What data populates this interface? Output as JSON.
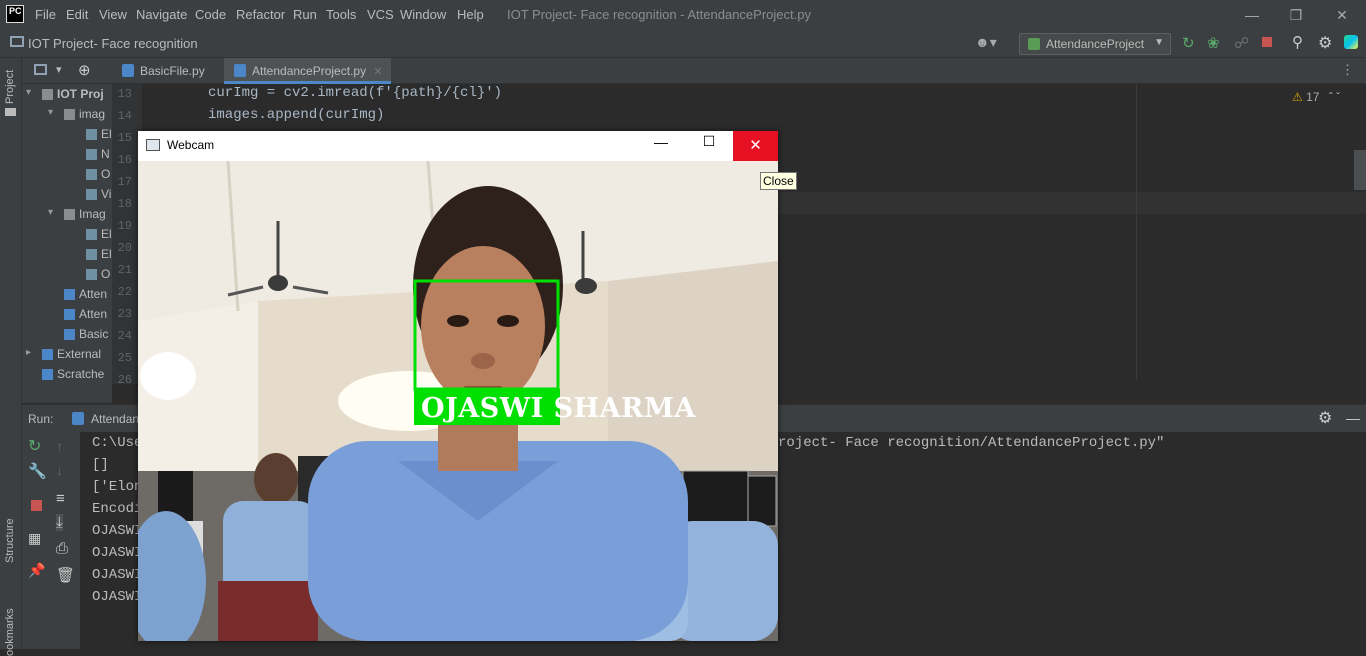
{
  "app": {
    "logo": "PC",
    "window_title": "IOT Project- Face recognition - AttendanceProject.py",
    "menu": [
      "File",
      "Edit",
      "View",
      "Navigate",
      "Code",
      "Refactor",
      "Run",
      "Tools",
      "VCS",
      "Window",
      "Help"
    ]
  },
  "navbar": {
    "project": "IOT Project- Face recognition",
    "run_config": "AttendanceProject"
  },
  "sidebar": {
    "project_label": "Project",
    "structure_label": "Structure",
    "bookmarks_label": "ookmarks"
  },
  "project_tree": [
    {
      "label": "IOT Proj",
      "indent": 0
    },
    {
      "label": "imag",
      "indent": 1
    },
    {
      "label": "El",
      "indent": 2
    },
    {
      "label": "N",
      "indent": 2
    },
    {
      "label": "O",
      "indent": 2
    },
    {
      "label": "Vi",
      "indent": 2
    },
    {
      "label": "Imag",
      "indent": 1
    },
    {
      "label": "El",
      "indent": 2
    },
    {
      "label": "El",
      "indent": 2
    },
    {
      "label": "O",
      "indent": 2
    },
    {
      "label": "Atten",
      "indent": 1
    },
    {
      "label": "Atten",
      "indent": 1
    },
    {
      "label": "Basic",
      "indent": 1
    },
    {
      "label": "External",
      "indent": 0
    },
    {
      "label": "Scratche",
      "indent": 0
    }
  ],
  "tabs": [
    {
      "label": "BasicFile.py",
      "active": false
    },
    {
      "label": "AttendanceProject.py",
      "active": true
    }
  ],
  "editor": {
    "line_numbers": [
      "13",
      "14",
      "15",
      "16",
      "17",
      "18",
      "19",
      "20",
      "21",
      "22",
      "23",
      "24",
      "25",
      "26"
    ],
    "code": [
      "curImg = cv2.imread(f'{path}/{cl}')",
      "images.append(curImg)"
    ],
    "warnings": "17"
  },
  "run": {
    "label": "Run:",
    "config": "Attendanc",
    "output": [
      "C:\\Use",
      "[]",
      "['Elon",
      "Encodi",
      "OJASWI",
      "OJASWI",
      "OJASWI",
      "OJASWI"
    ],
    "output_tail": "roject- Face recognition/AttendanceProject.py\""
  },
  "webcam": {
    "title": "Webcam",
    "detected_name": "OJASWI SHARMA",
    "tooltip": "Close",
    "box_color": "#00e000"
  }
}
